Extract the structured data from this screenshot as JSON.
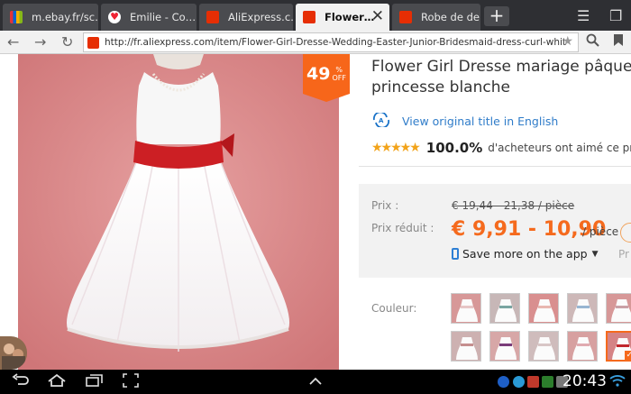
{
  "browser": {
    "tabs": [
      {
        "label": "m.ebay.fr/sc…",
        "active": false
      },
      {
        "label": "Emilie - Co…",
        "active": false
      },
      {
        "label": "AliExpress.c…",
        "active": false
      },
      {
        "label": "Flower…",
        "active": true
      },
      {
        "label": "Robe de de…",
        "active": false
      }
    ],
    "new_tab_label": "+",
    "url": "http://fr.aliexpress.com/item/Flower-Girl-Dresse-Wedding-Easter-Junior-Bridesmaid-dress-curl-white-princess-girl"
  },
  "product": {
    "discount_value": "49",
    "discount_percent": "%",
    "discount_off": "OFF",
    "title_line1": "Flower Girl Dresse mariage pâques",
    "title_line2": "princesse blanche",
    "translate_link": "View original title in English",
    "rating_percent": "100.0%",
    "rating_text": "d'acheteurs ont aimé ce pro",
    "price_label": "Prix :",
    "old_price": "€ 19,44 - 21,38 / pièce",
    "reduced_label": "Prix réduit :",
    "new_price": "€ 9,91 - 10,90",
    "unit": "/ pièce",
    "save_app": "Save more on the app",
    "price_fragment": "Pr",
    "color_label": "Couleur:"
  },
  "system": {
    "clock": "20:43"
  },
  "colors": {
    "accent_orange": "#f56a1d",
    "sash_red": "#cc1f24",
    "link_blue": "#2f7cc9",
    "star_gold": "#f2a31a"
  },
  "swatches": [
    {
      "sash": "#e6c6c6",
      "bg": "#d79898"
    },
    {
      "sash": "#7aa6a2",
      "bg": "#c7b7b7"
    },
    {
      "sash": "#e8b7b0",
      "bg": "#d98f8f"
    },
    {
      "sash": "#98b6d2",
      "bg": "#cdb8b8"
    },
    {
      "sash": "#c9a0a6",
      "bg": "#d79898"
    },
    {
      "sash": "#6ea8c0",
      "bg": "#c6b9b9"
    },
    {
      "sash": "#c58f8f",
      "bg": "#cdb1b1"
    },
    {
      "sash": "#7a3c7a",
      "bg": "#d7a7a7"
    },
    {
      "sash": "#d8c6c6",
      "bg": "#cfbcbc"
    },
    {
      "sash": "#e0aab0",
      "bg": "#d7a0a0"
    },
    {
      "sash": "#c1272d",
      "bg": "#d58385"
    },
    {
      "sash": "#a6a6a6",
      "bg": "#c9b5b5"
    }
  ]
}
